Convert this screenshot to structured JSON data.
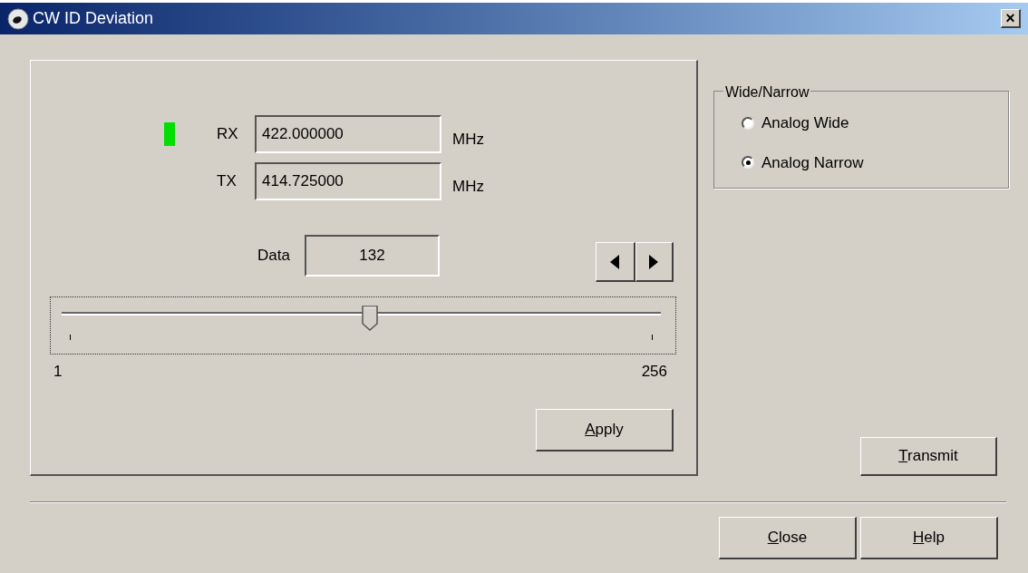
{
  "window": {
    "title": "CW ID Deviation",
    "close": "×"
  },
  "indicator": {
    "on": true,
    "color": "#00e000"
  },
  "frequencies": [
    {
      "label": "RX",
      "value": "422.000000",
      "unit": "MHz"
    },
    {
      "label": "TX",
      "value": "414.725000",
      "unit": "MHz"
    }
  ],
  "data": {
    "label": "Data",
    "value": "132"
  },
  "slider": {
    "level": 0.514,
    "min_label": "1",
    "max_label": "256"
  },
  "apply_button": "Apply",
  "wide_narrow": {
    "title": "Wide/Narrow",
    "options": [
      {
        "label": "Analog Wide",
        "selected": false
      },
      {
        "label": "Analog Narrow",
        "selected": true
      }
    ]
  },
  "transmit_button": "Transmit",
  "footer_buttons": [
    "Close",
    "Help"
  ]
}
